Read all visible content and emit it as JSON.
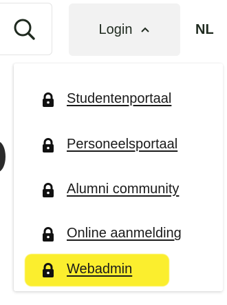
{
  "header": {
    "search_icon": "search-icon",
    "login_label": "Login",
    "login_chevron": "chevron-up-icon",
    "language_label": "NL"
  },
  "menu": {
    "items": [
      {
        "label": "Studentenportaal",
        "icon": "lock-icon"
      },
      {
        "label": "Personeelsportaal",
        "icon": "lock-icon"
      },
      {
        "label": "Alumni community",
        "icon": "lock-icon"
      },
      {
        "label": "Online aanmelding",
        "icon": "lock-icon"
      },
      {
        "label": "Webadmin",
        "icon": "lock-icon",
        "highlighted": true
      }
    ]
  },
  "colors": {
    "highlight": "#fbee2e",
    "login_bg": "#f2f2f2",
    "text": "#1a1a1a"
  }
}
